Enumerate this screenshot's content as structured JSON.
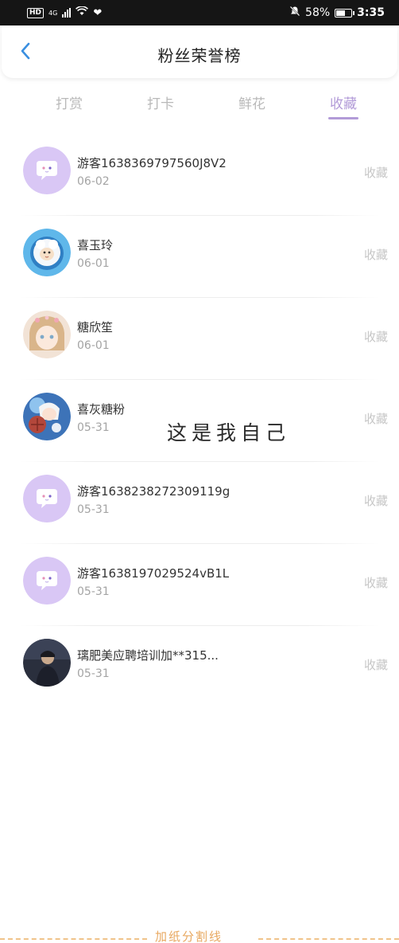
{
  "status_bar": {
    "left_badge": "HD",
    "signal_label": "4G",
    "battery": "58%",
    "time": "3:35"
  },
  "header": {
    "title": "粉丝荣誉榜"
  },
  "tabs": [
    {
      "label": "打赏",
      "active": false
    },
    {
      "label": "打卡",
      "active": false
    },
    {
      "label": "鲜花",
      "active": false
    },
    {
      "label": "收藏",
      "active": true
    }
  ],
  "list": [
    {
      "name": "游客1638369797560J8V2",
      "date": "06-02",
      "action": "收藏",
      "avatar": "default-chat-avatar"
    },
    {
      "name": "喜玉玲",
      "date": "06-01",
      "action": "收藏",
      "avatar": "cartoon-sheep-avatar"
    },
    {
      "name": "糖欣笙",
      "date": "06-01",
      "action": "收藏",
      "avatar": "anime-girl-avatar"
    },
    {
      "name": "喜灰糖粉",
      "date": "05-31",
      "action": "收藏",
      "avatar": "anime-character-avatar"
    },
    {
      "name": "游客1638238272309119g",
      "date": "05-31",
      "action": "收藏",
      "avatar": "default-chat-avatar"
    },
    {
      "name": "游客1638197029524vB1L",
      "date": "05-31",
      "action": "收藏",
      "avatar": "default-chat-avatar"
    },
    {
      "name": "璃肥美应聘培训加**315...",
      "date": "05-31",
      "action": "收藏",
      "avatar": "photo-person-avatar"
    }
  ],
  "annotation": "这是我自己",
  "bottom_divider": "加纸分割线",
  "colors": {
    "accent": "#b29bd8",
    "default_avatar_bg": "#d9c7f5",
    "divider_orange": "#f0c38a"
  }
}
